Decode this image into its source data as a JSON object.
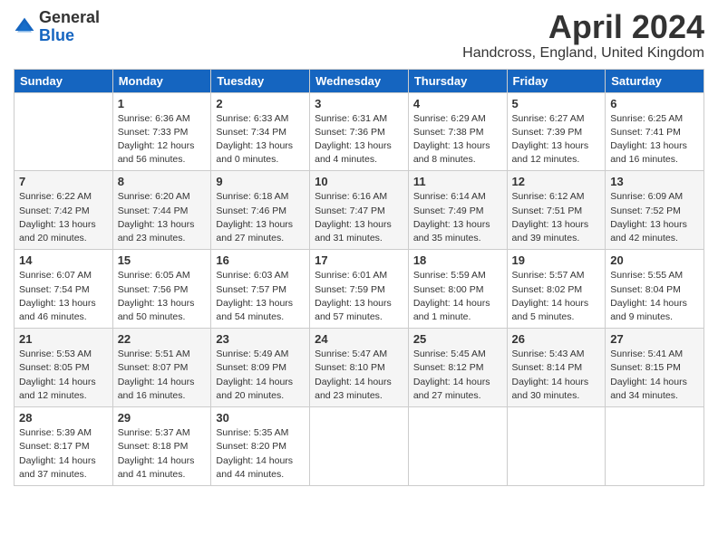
{
  "logo": {
    "general": "General",
    "blue": "Blue"
  },
  "title": "April 2024",
  "location": "Handcross, England, United Kingdom",
  "days_header": [
    "Sunday",
    "Monday",
    "Tuesday",
    "Wednesday",
    "Thursday",
    "Friday",
    "Saturday"
  ],
  "weeks": [
    [
      {
        "day": "",
        "info": ""
      },
      {
        "day": "1",
        "info": "Sunrise: 6:36 AM\nSunset: 7:33 PM\nDaylight: 12 hours\nand 56 minutes."
      },
      {
        "day": "2",
        "info": "Sunrise: 6:33 AM\nSunset: 7:34 PM\nDaylight: 13 hours\nand 0 minutes."
      },
      {
        "day": "3",
        "info": "Sunrise: 6:31 AM\nSunset: 7:36 PM\nDaylight: 13 hours\nand 4 minutes."
      },
      {
        "day": "4",
        "info": "Sunrise: 6:29 AM\nSunset: 7:38 PM\nDaylight: 13 hours\nand 8 minutes."
      },
      {
        "day": "5",
        "info": "Sunrise: 6:27 AM\nSunset: 7:39 PM\nDaylight: 13 hours\nand 12 minutes."
      },
      {
        "day": "6",
        "info": "Sunrise: 6:25 AM\nSunset: 7:41 PM\nDaylight: 13 hours\nand 16 minutes."
      }
    ],
    [
      {
        "day": "7",
        "info": "Sunrise: 6:22 AM\nSunset: 7:42 PM\nDaylight: 13 hours\nand 20 minutes."
      },
      {
        "day": "8",
        "info": "Sunrise: 6:20 AM\nSunset: 7:44 PM\nDaylight: 13 hours\nand 23 minutes."
      },
      {
        "day": "9",
        "info": "Sunrise: 6:18 AM\nSunset: 7:46 PM\nDaylight: 13 hours\nand 27 minutes."
      },
      {
        "day": "10",
        "info": "Sunrise: 6:16 AM\nSunset: 7:47 PM\nDaylight: 13 hours\nand 31 minutes."
      },
      {
        "day": "11",
        "info": "Sunrise: 6:14 AM\nSunset: 7:49 PM\nDaylight: 13 hours\nand 35 minutes."
      },
      {
        "day": "12",
        "info": "Sunrise: 6:12 AM\nSunset: 7:51 PM\nDaylight: 13 hours\nand 39 minutes."
      },
      {
        "day": "13",
        "info": "Sunrise: 6:09 AM\nSunset: 7:52 PM\nDaylight: 13 hours\nand 42 minutes."
      }
    ],
    [
      {
        "day": "14",
        "info": "Sunrise: 6:07 AM\nSunset: 7:54 PM\nDaylight: 13 hours\nand 46 minutes."
      },
      {
        "day": "15",
        "info": "Sunrise: 6:05 AM\nSunset: 7:56 PM\nDaylight: 13 hours\nand 50 minutes."
      },
      {
        "day": "16",
        "info": "Sunrise: 6:03 AM\nSunset: 7:57 PM\nDaylight: 13 hours\nand 54 minutes."
      },
      {
        "day": "17",
        "info": "Sunrise: 6:01 AM\nSunset: 7:59 PM\nDaylight: 13 hours\nand 57 minutes."
      },
      {
        "day": "18",
        "info": "Sunrise: 5:59 AM\nSunset: 8:00 PM\nDaylight: 14 hours\nand 1 minute."
      },
      {
        "day": "19",
        "info": "Sunrise: 5:57 AM\nSunset: 8:02 PM\nDaylight: 14 hours\nand 5 minutes."
      },
      {
        "day": "20",
        "info": "Sunrise: 5:55 AM\nSunset: 8:04 PM\nDaylight: 14 hours\nand 9 minutes."
      }
    ],
    [
      {
        "day": "21",
        "info": "Sunrise: 5:53 AM\nSunset: 8:05 PM\nDaylight: 14 hours\nand 12 minutes."
      },
      {
        "day": "22",
        "info": "Sunrise: 5:51 AM\nSunset: 8:07 PM\nDaylight: 14 hours\nand 16 minutes."
      },
      {
        "day": "23",
        "info": "Sunrise: 5:49 AM\nSunset: 8:09 PM\nDaylight: 14 hours\nand 20 minutes."
      },
      {
        "day": "24",
        "info": "Sunrise: 5:47 AM\nSunset: 8:10 PM\nDaylight: 14 hours\nand 23 minutes."
      },
      {
        "day": "25",
        "info": "Sunrise: 5:45 AM\nSunset: 8:12 PM\nDaylight: 14 hours\nand 27 minutes."
      },
      {
        "day": "26",
        "info": "Sunrise: 5:43 AM\nSunset: 8:14 PM\nDaylight: 14 hours\nand 30 minutes."
      },
      {
        "day": "27",
        "info": "Sunrise: 5:41 AM\nSunset: 8:15 PM\nDaylight: 14 hours\nand 34 minutes."
      }
    ],
    [
      {
        "day": "28",
        "info": "Sunrise: 5:39 AM\nSunset: 8:17 PM\nDaylight: 14 hours\nand 37 minutes."
      },
      {
        "day": "29",
        "info": "Sunrise: 5:37 AM\nSunset: 8:18 PM\nDaylight: 14 hours\nand 41 minutes."
      },
      {
        "day": "30",
        "info": "Sunrise: 5:35 AM\nSunset: 8:20 PM\nDaylight: 14 hours\nand 44 minutes."
      },
      {
        "day": "",
        "info": ""
      },
      {
        "day": "",
        "info": ""
      },
      {
        "day": "",
        "info": ""
      },
      {
        "day": "",
        "info": ""
      }
    ]
  ]
}
